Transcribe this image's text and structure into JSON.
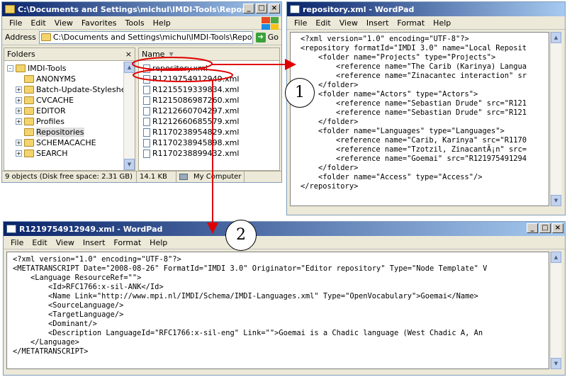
{
  "explorer": {
    "title": "C:\\Documents and Settings\\michul\\IMDI-Tools\\Repositories",
    "menu": [
      "File",
      "Edit",
      "View",
      "Favorites",
      "Tools",
      "Help"
    ],
    "address_label": "Address",
    "address_value": "C:\\Documents and Settings\\michul\\IMDI-Tools\\Repositories",
    "go_label": "Go",
    "folders_header": "Folders",
    "name_header": "Name",
    "tree": [
      {
        "label": "IMDI-Tools",
        "expander": "-",
        "level": 0
      },
      {
        "label": "ANONYMS",
        "expander": "",
        "level": 1
      },
      {
        "label": "Batch-Update-Stylesheets",
        "expander": "+",
        "level": 1
      },
      {
        "label": "CVCACHE",
        "expander": "+",
        "level": 1
      },
      {
        "label": "EDITOR",
        "expander": "+",
        "level": 1
      },
      {
        "label": "Profiles",
        "expander": "+",
        "level": 1
      },
      {
        "label": "Repositories",
        "expander": "",
        "level": 1
      },
      {
        "label": "SCHEMACACHE",
        "expander": "+",
        "level": 1
      },
      {
        "label": "SEARCH",
        "expander": "+",
        "level": 1
      }
    ],
    "files": [
      "repository.xml",
      "R1219754912949.xml",
      "R1215519339834.xml",
      "R1215086987260.xml",
      "R1212660704297.xml",
      "R1212660685579.xml",
      "R1170238954829.xml",
      "R1170238945898.xml",
      "R1170238899432.xml"
    ],
    "status_left": "9 objects (Disk free space: 2.31 GB)",
    "status_size": "14.1 KB",
    "status_location": "My Computer"
  },
  "wordpad_repo": {
    "title": "repository.xml - WordPad",
    "menu": [
      "File",
      "Edit",
      "View",
      "Insert",
      "Format",
      "Help"
    ],
    "lines": [
      "<?xml version=\"1.0\" encoding=\"UTF-8\"?>",
      "<repository formatId=\"IMDI 3.0\" name=\"Local Reposit",
      "    <folder name=\"Projects\" type=\"Projects\">",
      "        <reference name=\"The Carib (Karinya) Langua",
      "        <reference name=\"Zinacantec interaction\" sr",
      "    </folder>",
      "    <folder name=\"Actors\" type=\"Actors\">",
      "        <reference name=\"Sebastian Drude\" src=\"R121",
      "        <reference name=\"Sebastian Drude\" src=\"R121",
      "    </folder>",
      "    <folder name=\"Languages\" type=\"Languages\">",
      "        <reference name=\"Carib, Karinya\" src=\"R1170",
      "        <reference name=\"Tzotzil, ZinacantÃ¡n\" src=",
      "        <reference name=\"Goemai\" src=\"R121975491294",
      "    </folder>",
      "    <folder name=\"Access\" type=\"Access\"/>",
      "</repository>"
    ]
  },
  "wordpad_r": {
    "title": "R1219754912949.xml - WordPad",
    "menu": [
      "File",
      "Edit",
      "View",
      "Insert",
      "Format",
      "Help"
    ],
    "lines": [
      "<?xml version=\"1.0\" encoding=\"UTF-8\"?>",
      "<METATRANSCRIPT Date=\"2008-08-26\" FormatId=\"IMDI 3.0\" Originator=\"Editor repository\" Type=\"Node Template\" V",
      "    <Language ResourceRef=\"\">",
      "        <Id>RFC1766:x-sil-ANK</Id>",
      "        <Name Link=\"http://www.mpi.nl/IMDI/Schema/IMDI-Languages.xml\" Type=\"OpenVocabulary\">Goemai</Name>",
      "        <SourceLanguage/>",
      "        <TargetLanguage/>",
      "        <Dominant/>",
      "        <Description LanguageId=\"RFC1766:x-sil-eng\" Link=\"\">Goemai is a Chadic language (West Chadic A, An",
      "    </Language>",
      "</METATRANSCRIPT>"
    ]
  },
  "callouts": {
    "one": "1",
    "two": "2"
  },
  "colors": {
    "arrow": "#e00000",
    "highlight": "#e00000",
    "titlebar": "#0a246a"
  }
}
